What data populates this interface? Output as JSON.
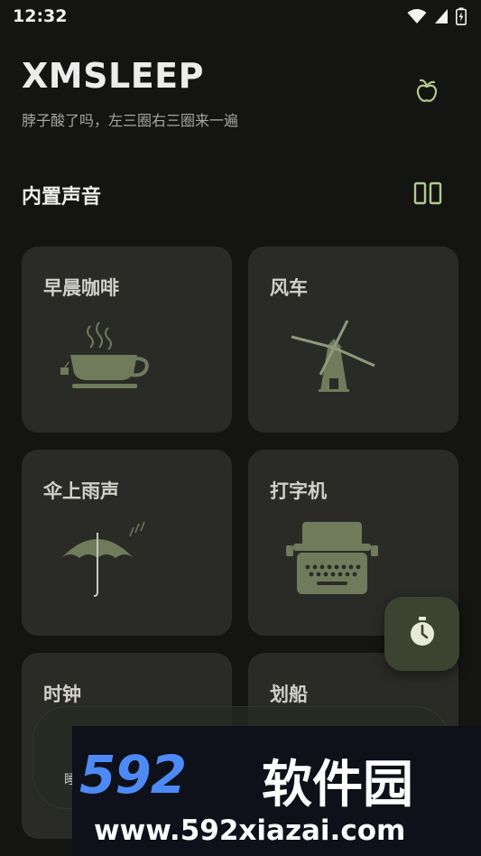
{
  "status_bar": {
    "time": "12:32"
  },
  "header": {
    "title": "XMSLEEP",
    "subtitle": "脖子酸了吗，左三圈右三圈来一遍",
    "icon": "apple-icon"
  },
  "section": {
    "title": "内置声音",
    "toggle_icon": "grid-view-icon"
  },
  "cards": [
    {
      "label": "早晨咖啡",
      "icon": "coffee-cup-icon"
    },
    {
      "label": "风车",
      "icon": "windmill-icon"
    },
    {
      "label": "伞上雨声",
      "icon": "umbrella-icon"
    },
    {
      "label": "打字机",
      "icon": "typewriter-icon"
    },
    {
      "label": "时钟",
      "icon": "clock-icon"
    },
    {
      "label": "划船",
      "icon": "rowing-icon"
    }
  ],
  "fab": {
    "icon": "timer-icon"
  },
  "bottom_nav": {
    "visible_label": "睡"
  },
  "watermark": {
    "brand_num": "592",
    "brand_text": "软件园",
    "url": "www.592xiazai.com"
  },
  "colors": {
    "background": "#141412",
    "card": "#2a2b27",
    "accent": "#b3c98f",
    "icon": "#6f7b5b"
  }
}
